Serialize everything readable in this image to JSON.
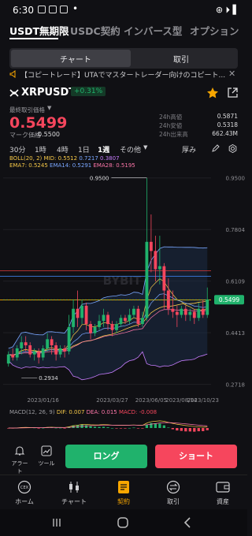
{
  "status_bar": {
    "time": "6:30",
    "right_text": "⊛ ⏵ ▌"
  },
  "top_tabs": [
    {
      "label": "USDT無期限",
      "active": true
    },
    {
      "label": "USDC契約",
      "active": false
    },
    {
      "label": "インバース型",
      "active": false
    },
    {
      "label": "オプション",
      "active": false
    }
  ],
  "segment": {
    "left": "チャート",
    "right": "取引"
  },
  "banner": "【コピートレード】UTAでマスタートレーダー向けのコピート...",
  "symbol": "XRPUSDT",
  "change_pct": "+0.31%",
  "last_price_label": "最終取引価格",
  "last_price": "0.5499",
  "mark_price_label": "マーク価格",
  "mark_price": "0.5500",
  "stats": [
    {
      "k": "24h高値",
      "v": "0.5871"
    },
    {
      "k": "24h安値",
      "v": "0.5318"
    },
    {
      "k": "24h出来高",
      "v": "662.43M"
    }
  ],
  "timeframes": {
    "items": [
      "30分",
      "1時",
      "4時",
      "1日",
      "1週"
    ],
    "active": "1週",
    "more": "その他",
    "depth": "厚み"
  },
  "indicators": {
    "boll": "BOLL(20, 2)",
    "boll_vals": [
      {
        "text": "MID: 0.5512",
        "color": "#f7c948"
      },
      {
        "text": "0.7217",
        "color": "#7aa7ff"
      },
      {
        "text": "0.3807",
        "color": "#c77dff"
      }
    ],
    "ema": [
      {
        "text": "EMA7: 0.5245",
        "color": "#f7c948"
      },
      {
        "text": "EMA14: 0.5291",
        "color": "#7aa7ff"
      },
      {
        "text": "EMA28: 0.5195",
        "color": "#ff77aa"
      }
    ]
  },
  "chart_data": {
    "type": "candlestick",
    "y_ticks": [
      0.95,
      0.7804,
      0.6109,
      0.4413,
      0.2718
    ],
    "ylim": [
      0.25,
      0.97
    ],
    "x_ticks": [
      "2023/01/16",
      "2023/03/27",
      "2023/06/05",
      "2023/08/14",
      "2023/10/23"
    ],
    "high_label": "0.9500",
    "low_label": "0.2934",
    "current_price": "0.5499",
    "watermark": "BYBIT",
    "candles": [
      [
        0.34,
        0.37,
        0.33,
        0.38
      ],
      [
        0.37,
        0.36,
        0.35,
        0.39
      ],
      [
        0.36,
        0.39,
        0.35,
        0.4
      ],
      [
        0.39,
        0.41,
        0.37,
        0.43
      ],
      [
        0.41,
        0.4,
        0.38,
        0.43
      ],
      [
        0.4,
        0.37,
        0.36,
        0.41
      ],
      [
        0.37,
        0.38,
        0.35,
        0.39
      ],
      [
        0.38,
        0.36,
        0.34,
        0.39
      ],
      [
        0.36,
        0.39,
        0.35,
        0.4
      ],
      [
        0.39,
        0.42,
        0.38,
        0.44
      ],
      [
        0.42,
        0.4,
        0.37,
        0.43
      ],
      [
        0.4,
        0.37,
        0.35,
        0.41
      ],
      [
        0.37,
        0.39,
        0.36,
        0.4
      ],
      [
        0.39,
        0.38,
        0.36,
        0.4
      ],
      [
        0.38,
        0.46,
        0.37,
        0.5
      ],
      [
        0.46,
        0.52,
        0.44,
        0.55
      ],
      [
        0.52,
        0.49,
        0.46,
        0.58
      ],
      [
        0.49,
        0.53,
        0.47,
        0.55
      ],
      [
        0.53,
        0.47,
        0.45,
        0.54
      ],
      [
        0.47,
        0.44,
        0.42,
        0.48
      ],
      [
        0.44,
        0.46,
        0.43,
        0.47
      ],
      [
        0.46,
        0.48,
        0.45,
        0.5
      ],
      [
        0.48,
        0.5,
        0.46,
        0.52
      ],
      [
        0.5,
        0.47,
        0.45,
        0.51
      ],
      [
        0.47,
        0.45,
        0.43,
        0.48
      ],
      [
        0.45,
        0.47,
        0.44,
        0.48
      ],
      [
        0.47,
        0.49,
        0.46,
        0.5
      ],
      [
        0.49,
        0.48,
        0.47,
        0.5
      ],
      [
        0.48,
        0.5,
        0.47,
        0.52
      ],
      [
        0.5,
        0.52,
        0.49,
        0.53
      ],
      [
        0.52,
        0.47,
        0.46,
        0.53
      ],
      [
        0.47,
        0.49,
        0.46,
        0.51
      ],
      [
        0.49,
        0.74,
        0.48,
        0.95
      ],
      [
        0.74,
        0.71,
        0.64,
        0.83
      ],
      [
        0.71,
        0.65,
        0.61,
        0.76
      ],
      [
        0.65,
        0.66,
        0.6,
        0.76
      ],
      [
        0.66,
        0.58,
        0.52,
        0.67
      ],
      [
        0.58,
        0.52,
        0.5,
        0.62
      ],
      [
        0.52,
        0.51,
        0.49,
        0.58
      ],
      [
        0.51,
        0.5,
        0.46,
        0.53
      ],
      [
        0.5,
        0.52,
        0.49,
        0.53
      ],
      [
        0.52,
        0.5,
        0.48,
        0.53
      ],
      [
        0.5,
        0.51,
        0.48,
        0.52
      ],
      [
        0.51,
        0.49,
        0.47,
        0.52
      ],
      [
        0.49,
        0.52,
        0.48,
        0.54
      ],
      [
        0.52,
        0.5,
        0.49,
        0.55
      ],
      [
        0.5,
        0.55,
        0.49,
        0.59
      ]
    ]
  },
  "macd": {
    "label": "MACD(12, 26, 9)",
    "dif": "DIF: 0.007",
    "dea": "DEA: 0.015",
    "macd": "MACD: -0.008",
    "dif_color": "#f7c948",
    "dea_color": "#ff77aa",
    "macd_color": "#f6465d"
  },
  "tools": [
    {
      "label": "アラート",
      "icon": "bell-icon"
    },
    {
      "label": "ツール",
      "icon": "chart-tool-icon"
    }
  ],
  "long_button": "ロング",
  "short_button": "ショート",
  "colors": {
    "up": "#20b26c",
    "down": "#f6465d",
    "accent": "#f7a600"
  },
  "bottom_tabs": [
    {
      "label": "ホーム",
      "icon": "home-cex-icon",
      "active": false
    },
    {
      "label": "チャート",
      "icon": "candles-icon",
      "active": false
    },
    {
      "label": "契約",
      "icon": "contract-icon",
      "active": true
    },
    {
      "label": "取引",
      "icon": "swap-icon",
      "active": false
    },
    {
      "label": "資産",
      "icon": "wallet-icon",
      "active": false
    }
  ]
}
